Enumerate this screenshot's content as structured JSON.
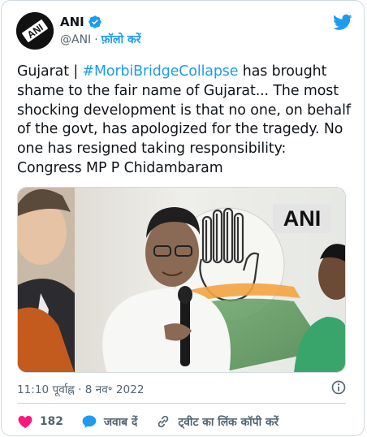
{
  "account": {
    "display_name": "ANI",
    "handle": "@ANI",
    "separator": "·",
    "follow_label": "फ़ॉलो करें",
    "avatar_text": "ANI"
  },
  "tweet": {
    "text_before": "Gujarat | ",
    "hashtag": "#MorbiBridgeCollapse",
    "text_after": " has brought shame to the fair name of Gujarat... The most shocking development is that no one, on behalf of the govt, has apologized for the tragedy. No one has resigned taking responsibility: Congress MP P Chidambaram"
  },
  "media": {
    "watermark": "ANI"
  },
  "meta": {
    "timestamp": "11:10 पूर्वाह्न · 8 नव॰ 2022"
  },
  "actions": {
    "like_count": "182",
    "reply_label": "जवाब दें",
    "copy_link_label": "ट्वीट का लिंक कॉपी करें"
  },
  "colors": {
    "accent": "#1d9bf0",
    "like": "#f91880",
    "secondary_text": "#536471"
  },
  "icons": [
    "verified-badge-icon",
    "twitter-bird-icon",
    "info-icon",
    "heart-icon",
    "reply-bubble-icon",
    "link-icon"
  ]
}
